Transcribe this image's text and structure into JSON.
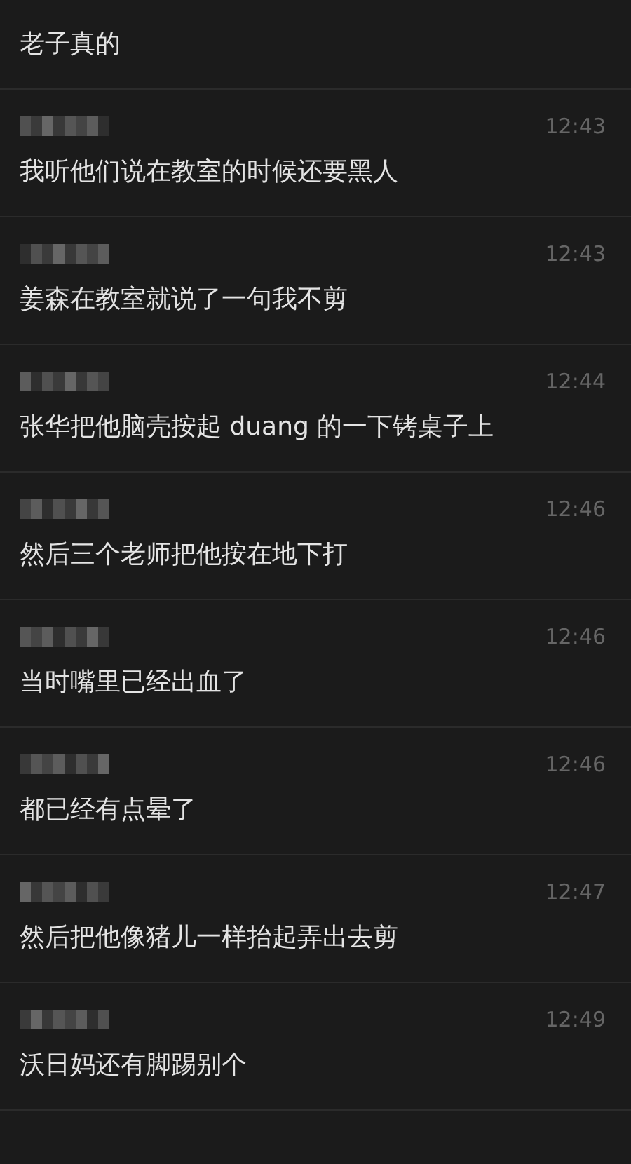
{
  "messages": [
    {
      "text": "老子真的"
    },
    {
      "time": "12:43",
      "text": "我听他们说在教室的时候还要黑人"
    },
    {
      "time": "12:43",
      "text": "姜森在教室就说了一句我不剪"
    },
    {
      "time": "12:44",
      "text": "张华把他脑壳按起 duang 的一下铐桌子上"
    },
    {
      "time": "12:46",
      "text": "然后三个老师把他按在地下打"
    },
    {
      "time": "12:46",
      "text": "当时嘴里已经出血了"
    },
    {
      "time": "12:46",
      "text": "都已经有点晕了"
    },
    {
      "time": "12:47",
      "text": "然后把他像猪儿一样抬起弄出去剪"
    },
    {
      "time": "12:49",
      "text": "沃日妈还有脚踢别个"
    }
  ]
}
